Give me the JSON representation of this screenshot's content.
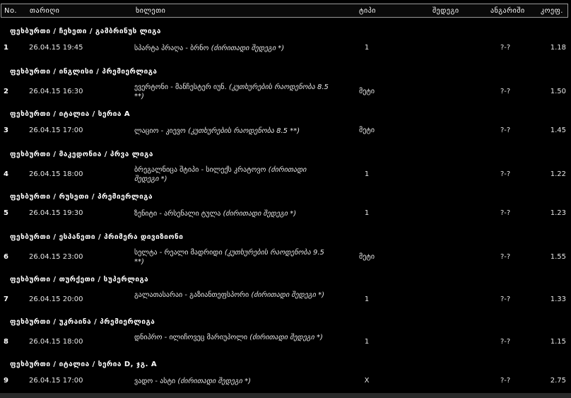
{
  "header": {
    "no": "No.",
    "date": "თარიღი",
    "event": "ხილეთი",
    "type": "ტიპი",
    "result": "შედეგი",
    "score": "ანგარიში",
    "odds": "კოეფ."
  },
  "groups": [
    {
      "league": "ფეხბურთი / ჩეხეთი / გამბრინუს ლიგა",
      "match": {
        "no": "1",
        "date": "26.04.15 19:45",
        "event": "სპარტა პრაღა - ბრნო",
        "note": "(ძირითადი შედეგი *)",
        "type": "1",
        "score": "?-?",
        "odds": "1.18"
      }
    },
    {
      "league": "ფეხბურთი / ინგლისი / პრემიერლიგა",
      "match": {
        "no": "2",
        "date": "26.04.15 16:30",
        "event": "ევერტონი - მანჩესტერ იუნ.",
        "note": "(კუთხურების რაოდენობა 8.5 **)",
        "type": "მეტი",
        "score": "?-?",
        "odds": "1.50"
      }
    },
    {
      "league": "ფეხბურთი / იტალია / სერია A",
      "match": {
        "no": "3",
        "date": "26.04.15 17:00",
        "event": "ლაციო - კიევო",
        "note": "(კუთხურების რაოდენობა 8.5 **)",
        "type": "მეტი",
        "score": "?-?",
        "odds": "1.45"
      }
    },
    {
      "league": "ფეხბურთი / მაკედონია / პრვა ლიგა",
      "match": {
        "no": "4",
        "date": "26.04.15 18:00",
        "event": "ბრეგალნიცა შტიპი - სილექს კრატოვო",
        "note": "(ძირითადი შედეგი *)",
        "type": "1",
        "score": "?-?",
        "odds": "1.22"
      }
    },
    {
      "league": "ფეხბურთი / რუსეთი / პრემიერლიგა",
      "match": {
        "no": "5",
        "date": "26.04.15 19:30",
        "event": "ზენიტი - არსენალი ტულა",
        "note": "(ძირითადი შედეგი *)",
        "type": "1",
        "score": "?-?",
        "odds": "1.23"
      }
    },
    {
      "league": "ფეხბურთი / ესპანეთი / პრიმერა დივიზიონი",
      "match": {
        "no": "6",
        "date": "26.04.15 23:00",
        "event": "სელტა - რეალი მადრიდი",
        "note": "(კუთხურების რაოდენობა 9.5 **)",
        "type": "მეტი",
        "score": "?-?",
        "odds": "1.55"
      }
    },
    {
      "league": "ფეხბურთი / თურქეთი / სუპერლიგა",
      "match": {
        "no": "7",
        "date": "26.04.15 20:00",
        "event": "გალათასარაი - გაზიანთეფსპორი",
        "note": "(ძირითადი შედეგი *)",
        "type": "1",
        "score": "?-?",
        "odds": "1.33"
      }
    },
    {
      "league": "ფეხბურთი / უკრაინა / პრემიერლიგა",
      "match": {
        "no": "8",
        "date": "26.04.15 18:00",
        "event": "დნიპრო - ილიჩოვეც მარიუპოლი",
        "note": "(ძირითადი შედეგი *)",
        "type": "1",
        "score": "?-?",
        "odds": "1.15"
      }
    },
    {
      "league": "ფეხბურთი / იტალია / სერია D, ჯგ. A",
      "match": {
        "no": "9",
        "date": "26.04.15 17:00",
        "event": "ვადო - ასტი",
        "note": "(ძირითადი შედეგი *)",
        "type": "X",
        "score": "?-?",
        "odds": "2.75"
      }
    }
  ]
}
